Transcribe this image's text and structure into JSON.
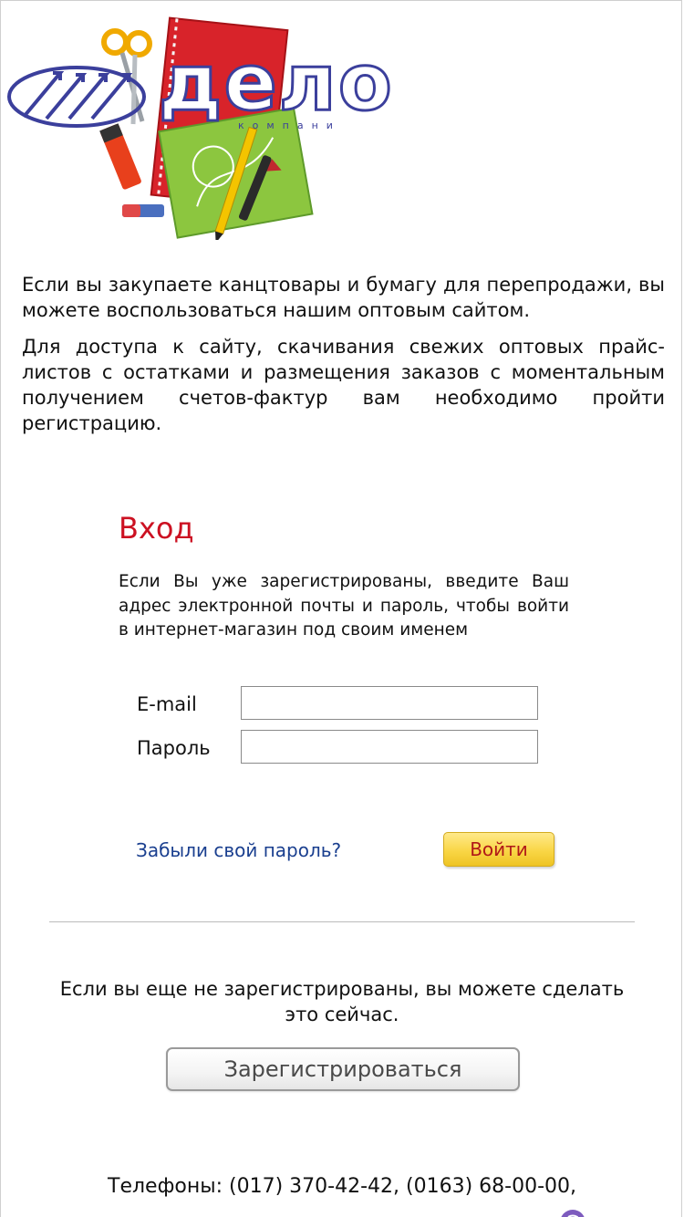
{
  "logo": {
    "brand_word": "дело",
    "brand_sub": "компани"
  },
  "intro": {
    "paragraph_1": "Если вы закупаете канцтовары и бумагу для перепродажи, вы можете воспользоваться нашим оптовым сайтом.",
    "paragraph_2": "Для доступа к сайту, скачивания свежих оптовых прайс-листов с остатками и размещения заказов с моментальным получением счетов-фактур вам необходимо пройти регистрацию."
  },
  "login": {
    "title": "Вход",
    "description": "Если Вы уже зарегистрированы, введите Ваш адрес электронной почты и пароль, чтобы войти в интернет-магазин под своим именем",
    "email_label": "E-mail",
    "email_value": "",
    "password_label": "Пароль",
    "password_value": "",
    "forgot_link": "Забыли свой пароль?",
    "submit_label": "Войти"
  },
  "register": {
    "text": "Если вы еще не зарегистрированы, вы можете сделать это сейчас.",
    "button_label": "Зарегистрироваться"
  },
  "footer": {
    "phones": "Телефоны: (017) 370-42-42, (0163) 68-00-00,"
  },
  "colors": {
    "title_red": "#cc1122",
    "link_blue": "#1a3f8f",
    "brand_blue": "#3b3f9c",
    "button_yellow": "#f9d646",
    "button_text_red": "#b01818"
  },
  "icons": {
    "logo_image": "stationery-logo-image",
    "viber": "viber-icon"
  }
}
